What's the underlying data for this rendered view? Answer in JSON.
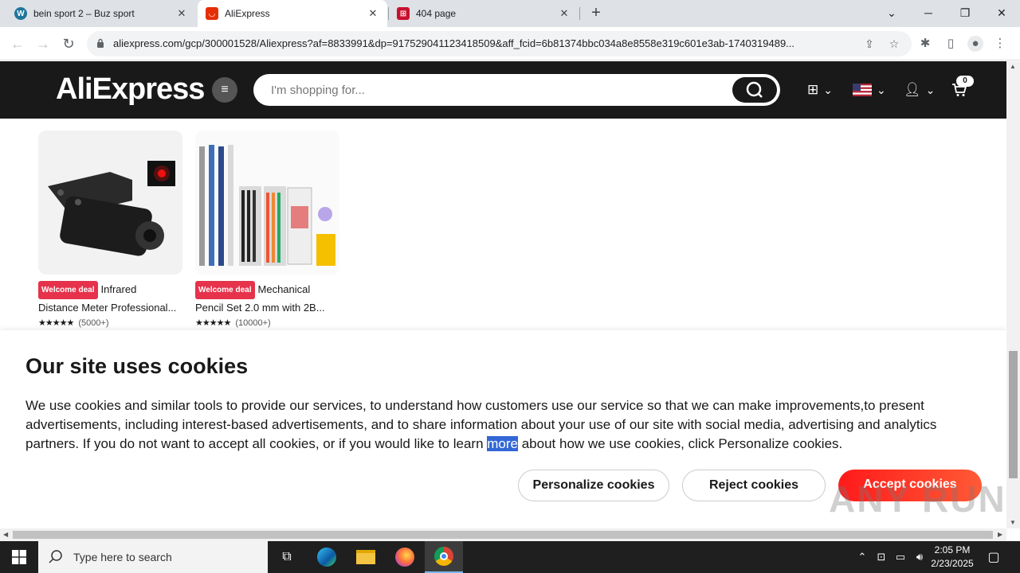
{
  "browser": {
    "tabs": [
      {
        "title": "bein sport 2 – Buz sport",
        "icon": "wordpress-icon"
      },
      {
        "title": "AliExpress",
        "icon": "aliexpress-icon",
        "active": true
      },
      {
        "title": "404 page",
        "icon": "cart-icon"
      }
    ],
    "new_tab": "+",
    "url": "aliexpress.com/gcp/300001528/Aliexpress?af=8833991&dp=9175290411234185​09&aff_fcid=6b81374bbc034a8e8558e319c601e3ab-1740319489..."
  },
  "header": {
    "logo": "AliExpress",
    "search_placeholder": "I'm shopping for...",
    "cart_count": "0"
  },
  "products": [
    {
      "badge": "Welcome deal",
      "title_line1": "Infrared",
      "title_line2": "Distance Meter Professional...",
      "stars": "★★★★★",
      "reviews": "(5000+)"
    },
    {
      "badge": "Welcome deal",
      "title_line1": "Mechanical",
      "title_line2": "Pencil Set 2.0 mm with 2B...",
      "stars": "★★★★★",
      "reviews": "(10000+)"
    }
  ],
  "cookie": {
    "title": "Our site uses cookies",
    "text_before": "We use cookies and similar tools to provide our services, to understand how customers use our service so that we can make improvements,to present advertisements, including interest-based advertisements, and to share information about your use of our site with social media, advertising and analytics partners. If you do not want to accept all cookies, or if you would like to learn ",
    "text_highlight": "more",
    "text_after": " about how we use cookies, click Personalize cookies.",
    "personalize": "Personalize cookies",
    "reject": "Reject cookies",
    "accept": "Accept cookies"
  },
  "watermark": "ANY RUN",
  "taskbar": {
    "search_placeholder": "Type here to search",
    "time": "2:05 PM",
    "date": "2/23/2025"
  },
  "colors": {
    "accent": "#ff2a1a",
    "header_bg": "#191919",
    "badge": "#e6324b"
  }
}
